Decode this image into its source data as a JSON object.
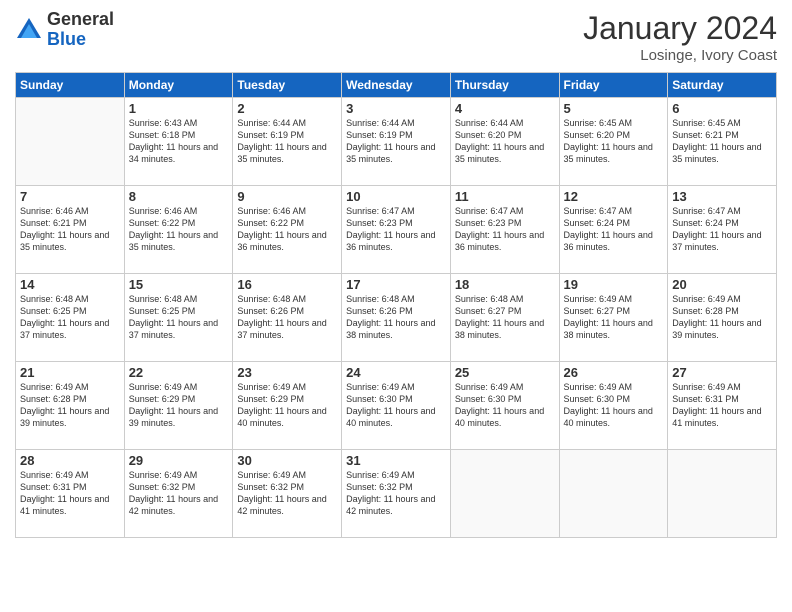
{
  "logo": {
    "general": "General",
    "blue": "Blue"
  },
  "title": "January 2024",
  "location": "Losinge, Ivory Coast",
  "days_of_week": [
    "Sunday",
    "Monday",
    "Tuesday",
    "Wednesday",
    "Thursday",
    "Friday",
    "Saturday"
  ],
  "weeks": [
    [
      {
        "day": "",
        "sunrise": "",
        "sunset": "",
        "daylight": ""
      },
      {
        "day": "1",
        "sunrise": "Sunrise: 6:43 AM",
        "sunset": "Sunset: 6:18 PM",
        "daylight": "Daylight: 11 hours and 34 minutes."
      },
      {
        "day": "2",
        "sunrise": "Sunrise: 6:44 AM",
        "sunset": "Sunset: 6:19 PM",
        "daylight": "Daylight: 11 hours and 35 minutes."
      },
      {
        "day": "3",
        "sunrise": "Sunrise: 6:44 AM",
        "sunset": "Sunset: 6:19 PM",
        "daylight": "Daylight: 11 hours and 35 minutes."
      },
      {
        "day": "4",
        "sunrise": "Sunrise: 6:44 AM",
        "sunset": "Sunset: 6:20 PM",
        "daylight": "Daylight: 11 hours and 35 minutes."
      },
      {
        "day": "5",
        "sunrise": "Sunrise: 6:45 AM",
        "sunset": "Sunset: 6:20 PM",
        "daylight": "Daylight: 11 hours and 35 minutes."
      },
      {
        "day": "6",
        "sunrise": "Sunrise: 6:45 AM",
        "sunset": "Sunset: 6:21 PM",
        "daylight": "Daylight: 11 hours and 35 minutes."
      }
    ],
    [
      {
        "day": "7",
        "sunrise": "Sunrise: 6:46 AM",
        "sunset": "Sunset: 6:21 PM",
        "daylight": "Daylight: 11 hours and 35 minutes."
      },
      {
        "day": "8",
        "sunrise": "Sunrise: 6:46 AM",
        "sunset": "Sunset: 6:22 PM",
        "daylight": "Daylight: 11 hours and 35 minutes."
      },
      {
        "day": "9",
        "sunrise": "Sunrise: 6:46 AM",
        "sunset": "Sunset: 6:22 PM",
        "daylight": "Daylight: 11 hours and 36 minutes."
      },
      {
        "day": "10",
        "sunrise": "Sunrise: 6:47 AM",
        "sunset": "Sunset: 6:23 PM",
        "daylight": "Daylight: 11 hours and 36 minutes."
      },
      {
        "day": "11",
        "sunrise": "Sunrise: 6:47 AM",
        "sunset": "Sunset: 6:23 PM",
        "daylight": "Daylight: 11 hours and 36 minutes."
      },
      {
        "day": "12",
        "sunrise": "Sunrise: 6:47 AM",
        "sunset": "Sunset: 6:24 PM",
        "daylight": "Daylight: 11 hours and 36 minutes."
      },
      {
        "day": "13",
        "sunrise": "Sunrise: 6:47 AM",
        "sunset": "Sunset: 6:24 PM",
        "daylight": "Daylight: 11 hours and 37 minutes."
      }
    ],
    [
      {
        "day": "14",
        "sunrise": "Sunrise: 6:48 AM",
        "sunset": "Sunset: 6:25 PM",
        "daylight": "Daylight: 11 hours and 37 minutes."
      },
      {
        "day": "15",
        "sunrise": "Sunrise: 6:48 AM",
        "sunset": "Sunset: 6:25 PM",
        "daylight": "Daylight: 11 hours and 37 minutes."
      },
      {
        "day": "16",
        "sunrise": "Sunrise: 6:48 AM",
        "sunset": "Sunset: 6:26 PM",
        "daylight": "Daylight: 11 hours and 37 minutes."
      },
      {
        "day": "17",
        "sunrise": "Sunrise: 6:48 AM",
        "sunset": "Sunset: 6:26 PM",
        "daylight": "Daylight: 11 hours and 38 minutes."
      },
      {
        "day": "18",
        "sunrise": "Sunrise: 6:48 AM",
        "sunset": "Sunset: 6:27 PM",
        "daylight": "Daylight: 11 hours and 38 minutes."
      },
      {
        "day": "19",
        "sunrise": "Sunrise: 6:49 AM",
        "sunset": "Sunset: 6:27 PM",
        "daylight": "Daylight: 11 hours and 38 minutes."
      },
      {
        "day": "20",
        "sunrise": "Sunrise: 6:49 AM",
        "sunset": "Sunset: 6:28 PM",
        "daylight": "Daylight: 11 hours and 39 minutes."
      }
    ],
    [
      {
        "day": "21",
        "sunrise": "Sunrise: 6:49 AM",
        "sunset": "Sunset: 6:28 PM",
        "daylight": "Daylight: 11 hours and 39 minutes."
      },
      {
        "day": "22",
        "sunrise": "Sunrise: 6:49 AM",
        "sunset": "Sunset: 6:29 PM",
        "daylight": "Daylight: 11 hours and 39 minutes."
      },
      {
        "day": "23",
        "sunrise": "Sunrise: 6:49 AM",
        "sunset": "Sunset: 6:29 PM",
        "daylight": "Daylight: 11 hours and 40 minutes."
      },
      {
        "day": "24",
        "sunrise": "Sunrise: 6:49 AM",
        "sunset": "Sunset: 6:30 PM",
        "daylight": "Daylight: 11 hours and 40 minutes."
      },
      {
        "day": "25",
        "sunrise": "Sunrise: 6:49 AM",
        "sunset": "Sunset: 6:30 PM",
        "daylight": "Daylight: 11 hours and 40 minutes."
      },
      {
        "day": "26",
        "sunrise": "Sunrise: 6:49 AM",
        "sunset": "Sunset: 6:30 PM",
        "daylight": "Daylight: 11 hours and 40 minutes."
      },
      {
        "day": "27",
        "sunrise": "Sunrise: 6:49 AM",
        "sunset": "Sunset: 6:31 PM",
        "daylight": "Daylight: 11 hours and 41 minutes."
      }
    ],
    [
      {
        "day": "28",
        "sunrise": "Sunrise: 6:49 AM",
        "sunset": "Sunset: 6:31 PM",
        "daylight": "Daylight: 11 hours and 41 minutes."
      },
      {
        "day": "29",
        "sunrise": "Sunrise: 6:49 AM",
        "sunset": "Sunset: 6:32 PM",
        "daylight": "Daylight: 11 hours and 42 minutes."
      },
      {
        "day": "30",
        "sunrise": "Sunrise: 6:49 AM",
        "sunset": "Sunset: 6:32 PM",
        "daylight": "Daylight: 11 hours and 42 minutes."
      },
      {
        "day": "31",
        "sunrise": "Sunrise: 6:49 AM",
        "sunset": "Sunset: 6:32 PM",
        "daylight": "Daylight: 11 hours and 42 minutes."
      },
      {
        "day": "",
        "sunrise": "",
        "sunset": "",
        "daylight": ""
      },
      {
        "day": "",
        "sunrise": "",
        "sunset": "",
        "daylight": ""
      },
      {
        "day": "",
        "sunrise": "",
        "sunset": "",
        "daylight": ""
      }
    ]
  ]
}
